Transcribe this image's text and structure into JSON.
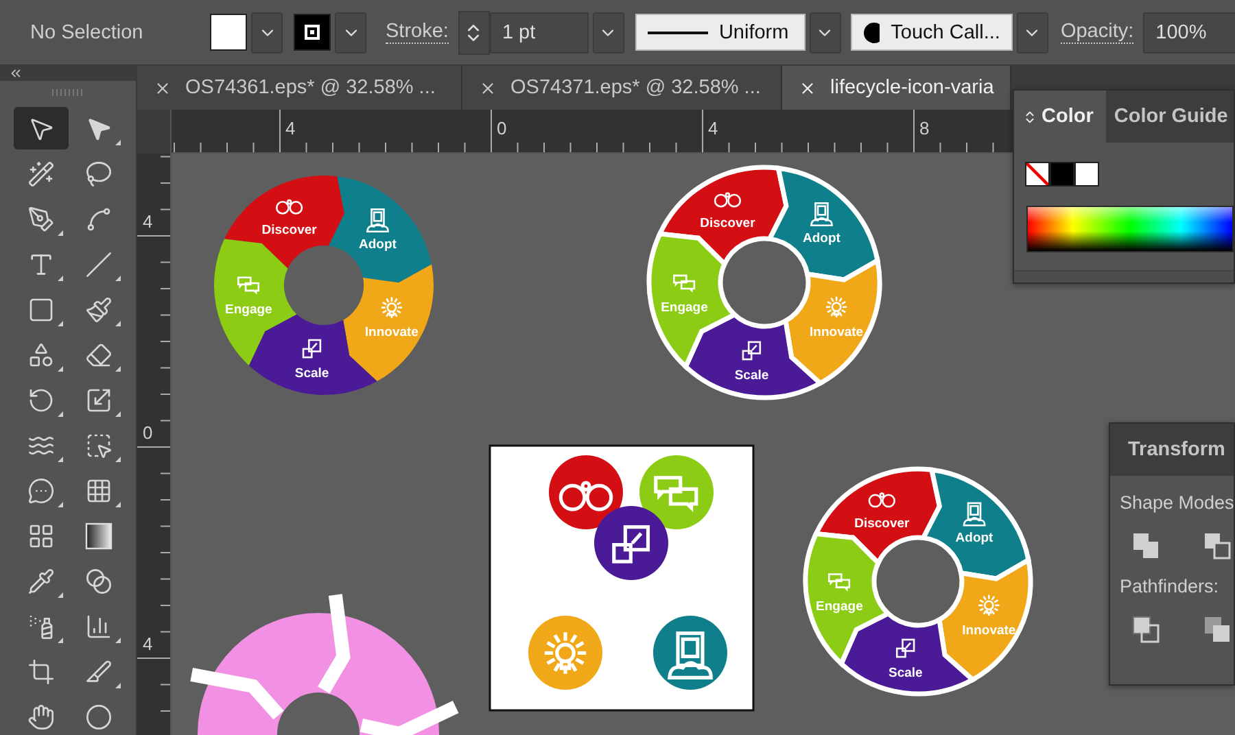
{
  "control_bar": {
    "selection": "No Selection",
    "stroke_label": "Stroke:",
    "stroke_weight": "1 pt",
    "profile": "Uniform",
    "brush": "Touch Call...",
    "opacity_label": "Opacity:",
    "opacity": "100%"
  },
  "tabs": [
    {
      "label": "OS74361.eps* @ 32.58% ...",
      "selected": false
    },
    {
      "label": "OS74371.eps* @ 32.58% ...",
      "selected": false
    },
    {
      "label": "lifecycle-icon-varia",
      "selected": true
    }
  ],
  "tools": [
    {
      "kind": "selection",
      "selected": true,
      "flyout": false
    },
    {
      "kind": "direct-selection",
      "selected": false,
      "flyout": true
    },
    {
      "kind": "magic-wand",
      "selected": false,
      "flyout": false
    },
    {
      "kind": "lasso",
      "selected": false,
      "flyout": false
    },
    {
      "kind": "pen",
      "selected": false,
      "flyout": true
    },
    {
      "kind": "curvature",
      "selected": false,
      "flyout": false
    },
    {
      "kind": "type",
      "selected": false,
      "flyout": true
    },
    {
      "kind": "line",
      "selected": false,
      "flyout": true
    },
    {
      "kind": "rectangle",
      "selected": false,
      "flyout": true
    },
    {
      "kind": "paintbrush",
      "selected": false,
      "flyout": true
    },
    {
      "kind": "shaper",
      "selected": false,
      "flyout": true
    },
    {
      "kind": "eraser",
      "selected": false,
      "flyout": true
    },
    {
      "kind": "rotate",
      "selected": false,
      "flyout": true
    },
    {
      "kind": "scale",
      "selected": false,
      "flyout": true
    },
    {
      "kind": "warp",
      "selected": false,
      "flyout": true
    },
    {
      "kind": "free-transform",
      "selected": false,
      "flyout": true
    },
    {
      "kind": "shape-builder",
      "selected": false,
      "flyout": true
    },
    {
      "kind": "perspective",
      "selected": false,
      "flyout": true
    },
    {
      "kind": "mesh",
      "selected": false,
      "flyout": false
    },
    {
      "kind": "gradient",
      "selected": false,
      "flyout": false
    },
    {
      "kind": "eyedropper",
      "selected": false,
      "flyout": true
    },
    {
      "kind": "blend",
      "selected": false,
      "flyout": false
    },
    {
      "kind": "symbol-sprayer",
      "selected": false,
      "flyout": true
    },
    {
      "kind": "graph",
      "selected": false,
      "flyout": true
    },
    {
      "kind": "artboard",
      "selected": false,
      "flyout": false
    },
    {
      "kind": "slice",
      "selected": false,
      "flyout": true
    },
    {
      "kind": "hand",
      "selected": false,
      "flyout": false
    },
    {
      "kind": "zoom",
      "selected": false,
      "flyout": false
    }
  ],
  "rulers": {
    "horizontal": [
      "4",
      "0",
      "4",
      "8"
    ],
    "vertical": [
      "4",
      "0",
      "4"
    ]
  },
  "diagrams": [
    {
      "segments": [
        {
          "label": "Discover",
          "kind": "binoculars",
          "color": "#d40f14"
        },
        {
          "label": "Adopt",
          "kind": "tablet",
          "color": "#0f7f8c"
        },
        {
          "label": "Innovate",
          "kind": "bulb",
          "color": "#f0a818"
        },
        {
          "label": "Scale",
          "kind": "squares",
          "color": "#4b1a96"
        },
        {
          "label": "Engage",
          "kind": "chat",
          "color": "#8ccc14"
        }
      ]
    },
    {
      "segments": [
        {
          "label": "Discover",
          "kind": "binoculars",
          "color": "#d40f14"
        },
        {
          "label": "Adopt",
          "kind": "tablet",
          "color": "#0f7f8c"
        },
        {
          "label": "Innovate",
          "kind": "bulb",
          "color": "#f0a818"
        },
        {
          "label": "Scale",
          "kind": "squares",
          "color": "#4b1a96"
        },
        {
          "label": "Engage",
          "kind": "chat",
          "color": "#8ccc14"
        }
      ]
    },
    {
      "segments": [
        {
          "label": "Discover",
          "kind": "binoculars",
          "color": "#d40f14"
        },
        {
          "label": "Adopt",
          "kind": "tablet",
          "color": "#0f7f8c"
        },
        {
          "label": "Innovate",
          "kind": "bulb",
          "color": "#f0a818"
        },
        {
          "label": "Scale",
          "kind": "squares",
          "color": "#4b1a96"
        },
        {
          "label": "Engage",
          "kind": "chat",
          "color": "#8ccc14"
        }
      ]
    },
    {
      "color": "#f291e3"
    }
  ],
  "icon_sheet": {
    "badges": [
      {
        "kind": "binoculars",
        "color": "#d40f14"
      },
      {
        "kind": "chat",
        "color": "#8ccc14"
      },
      {
        "kind": "squares",
        "color": "#4b1a96"
      },
      {
        "kind": "bulb",
        "color": "#f0a818"
      },
      {
        "kind": "tablet",
        "color": "#0f7f8c"
      }
    ]
  },
  "color_panel": {
    "tabs": [
      {
        "label": "Color",
        "selected": true
      },
      {
        "label": "Color Guide",
        "selected": false
      }
    ]
  },
  "pathfinder_panel": {
    "tabs": [
      {
        "label": "Transform",
        "selected": false
      }
    ],
    "shape_modes_label": "Shape Modes",
    "pathfinders_label": "Pathfinders:"
  }
}
